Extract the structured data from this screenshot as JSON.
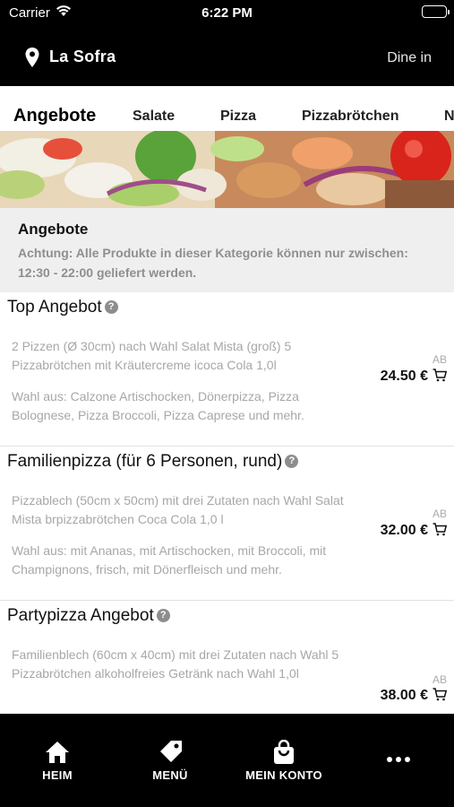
{
  "status_bar": {
    "carrier": "Carrier",
    "time": "6:22 PM"
  },
  "header": {
    "store_name": "La Sofra",
    "service_mode": "Dine in"
  },
  "category_tabs": [
    {
      "label": "Angebote",
      "active": true
    },
    {
      "label": "Salate",
      "active": false
    },
    {
      "label": "Pizza",
      "active": false
    },
    {
      "label": "Pizzabrötchen",
      "active": false
    },
    {
      "label": "N",
      "active": false
    }
  ],
  "category": {
    "title": "Angebote",
    "note": "Achtung: Alle Produkte in dieser Kategorie können nur zwischen: 12:30 - 22:00 geliefert werden."
  },
  "products": [
    {
      "title": "Top Angebot",
      "help": "?",
      "description": "2 Pizzen (Ø 30cm) nach Wahl Salat Mista (groß) 5 Pizzabrötchen mit Kräutercreme icoca Cola 1,0l",
      "options": "Wahl aus: Calzone Artischocken, Dönerpizza, Pizza Bolognese, Pizza Broccoli, Pizza Caprese und mehr.",
      "price_prefix": "AB",
      "price": "24.50 €"
    },
    {
      "title": "Familienpizza (für 6 Personen, rund)",
      "help": "?",
      "description": "Pizzablech (50cm x 50cm) mit drei Zutaten nach Wahl Salat Mista brpizzabrötchen Coca Cola 1,0 l",
      "options": "Wahl aus: mit Ananas, mit Artischocken, mit Broccoli, mit Champignons, frisch, mit Dönerfleisch und mehr.",
      "price_prefix": "AB",
      "price": "32.00 €"
    },
    {
      "title": "Partypizza Angebot",
      "help": "?",
      "description": "Familienblech (60cm x 40cm) mit drei Zutaten nach Wahl 5 Pizzabrötchen alkoholfreies Getränk nach Wahl 1,0l",
      "price_prefix": "AB",
      "price": "38.00 €"
    }
  ],
  "bottom_nav": [
    {
      "label": "HEIM",
      "icon": "home-icon"
    },
    {
      "label": "MENÜ",
      "icon": "tag-icon"
    },
    {
      "label": "MEIN KONTO",
      "icon": "bag-icon"
    },
    {
      "label": "",
      "icon": "more-icon"
    }
  ],
  "colors": {
    "header_bg": "#000000",
    "category_bg": "#efefef",
    "muted_text": "#a7a7a7"
  }
}
